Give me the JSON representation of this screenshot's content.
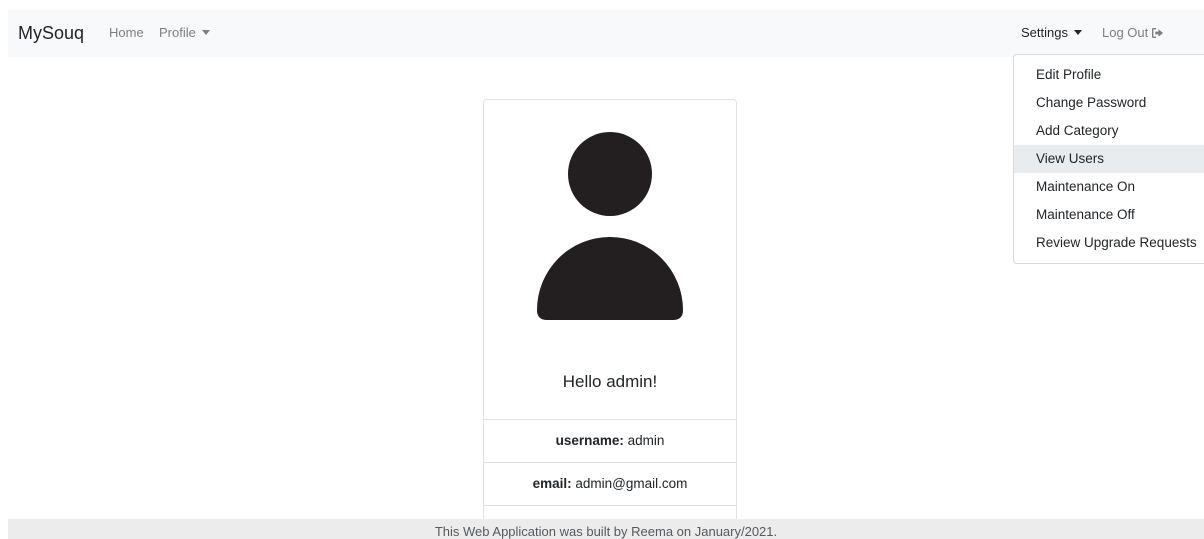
{
  "navbar": {
    "brand": "MySouq",
    "home_label": "Home",
    "profile_label": "Profile",
    "settings_label": "Settings",
    "logout_label": "Log Out"
  },
  "settings_menu": {
    "items": [
      {
        "label": "Edit Profile"
      },
      {
        "label": "Change Password"
      },
      {
        "label": "Add Category"
      },
      {
        "label": "View Users"
      },
      {
        "label": "Maintenance On"
      },
      {
        "label": "Maintenance Off"
      },
      {
        "label": "Review Upgrade Requests"
      }
    ],
    "hovered_item": "View Users"
  },
  "profile_card": {
    "greeting": "Hello admin!",
    "username_key": "username:",
    "username_value": "admin",
    "email_key": "email:",
    "email_value": "admin@gmail.com"
  },
  "footer": {
    "text": "This Web Application was built by Reema on January/2021."
  },
  "icons": {
    "avatar": "person-silhouette-icon",
    "logout": "sign-out-icon",
    "dropdown": "caret-down-icon"
  },
  "colors": {
    "navbar_bg": "#f8f9fa",
    "avatar_fill": "#231f20",
    "hover_bg": "#e9ecef",
    "footer_bg": "#ececec"
  }
}
